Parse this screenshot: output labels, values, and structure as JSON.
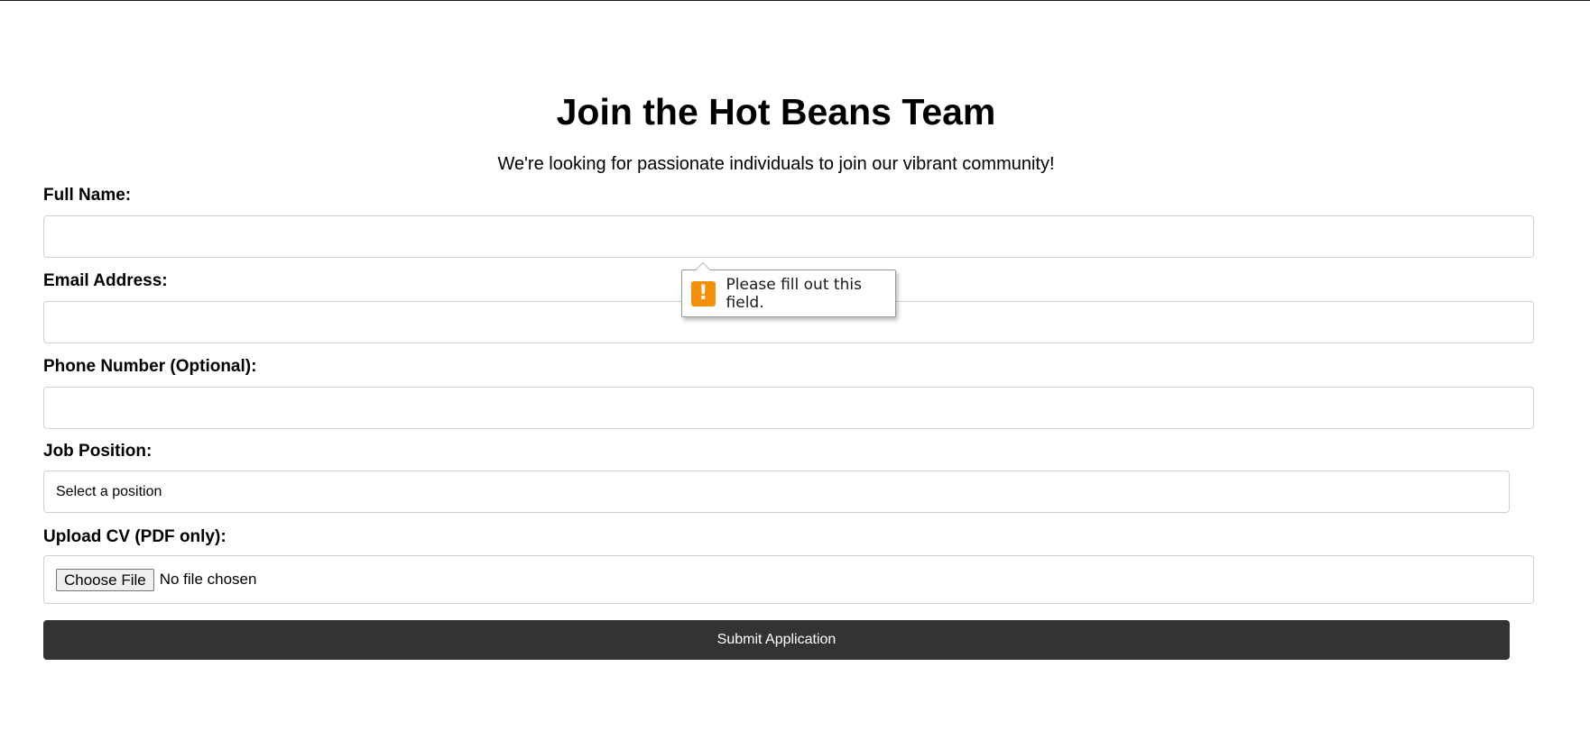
{
  "page": {
    "title": "Join the Hot Beans Team",
    "subtitle": "We're looking for passionate individuals to join our vibrant community!"
  },
  "form": {
    "full_name": {
      "label": "Full Name:",
      "value": "",
      "placeholder": ""
    },
    "email": {
      "label": "Email Address:",
      "value": "",
      "placeholder": ""
    },
    "phone": {
      "label": "Phone Number (Optional):",
      "value": "",
      "placeholder": ""
    },
    "job_position": {
      "label": "Job Position:",
      "selected": "Select a position"
    },
    "cv_upload": {
      "label": "Upload CV (PDF only):",
      "button_label": "Choose File",
      "status": "No file chosen"
    },
    "submit_label": "Submit Application"
  },
  "validation_tooltip": {
    "message": "Please fill out this field.",
    "icon": "warning-icon",
    "icon_glyph": "!",
    "icon_color": "#f5900c"
  },
  "colors": {
    "submit_background": "#333333",
    "submit_text": "#ffffff"
  }
}
